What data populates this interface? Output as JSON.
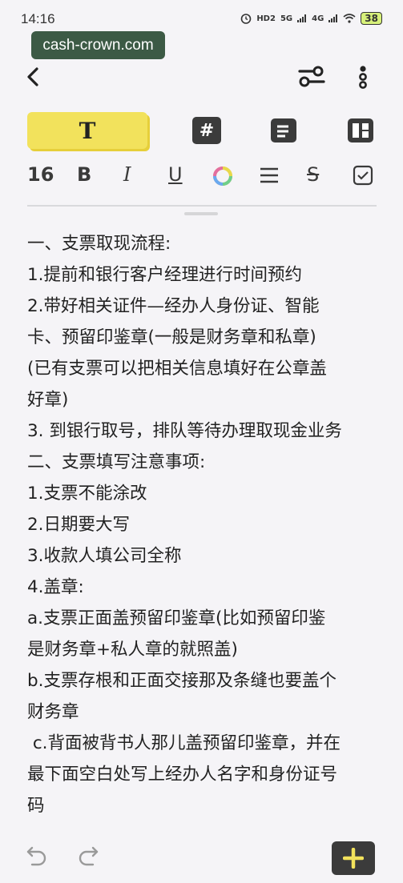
{
  "status": {
    "time": "14:16",
    "hd": "HD2",
    "net1": "5G",
    "net2": "4G",
    "battery": "38"
  },
  "watermark": "cash-crown.com",
  "format": {
    "text_label": "T",
    "hash_label": "#"
  },
  "style": {
    "font_size": "16",
    "bold": "B",
    "italic": "I",
    "underline": "U",
    "strike": "S"
  },
  "note": {
    "lines": [
      "一、支票取现流程:",
      "1.提前和银行客户经理进行时间预约",
      "2.带好相关证件—经办人身份证、智能",
      "卡、预留印鉴章(一般是财务章和私章)",
      "(已有支票可以把相关信息填好在公章盖",
      "好章)",
      "3. 到银行取号，排队等待办理取现金业务",
      "二、支票填写注意事项:",
      "1.支票不能涂改",
      "2.日期要大写",
      "3.收款人填公司全称",
      "4.盖章:",
      "a.支票正面盖预留印鉴章(比如预留印鉴",
      "是财务章+私人章的就照盖)",
      "b.支票存根和正面交接那及条缝也要盖个",
      "财务章",
      " c.背面被背书人那儿盖预留印鉴章，并在",
      "最下面空白处写上经办人名字和身份证号",
      "码"
    ]
  },
  "colors": {
    "accent": "#f2e25c",
    "dark": "#3b3b3b",
    "add_plus": "#f2e25c"
  }
}
